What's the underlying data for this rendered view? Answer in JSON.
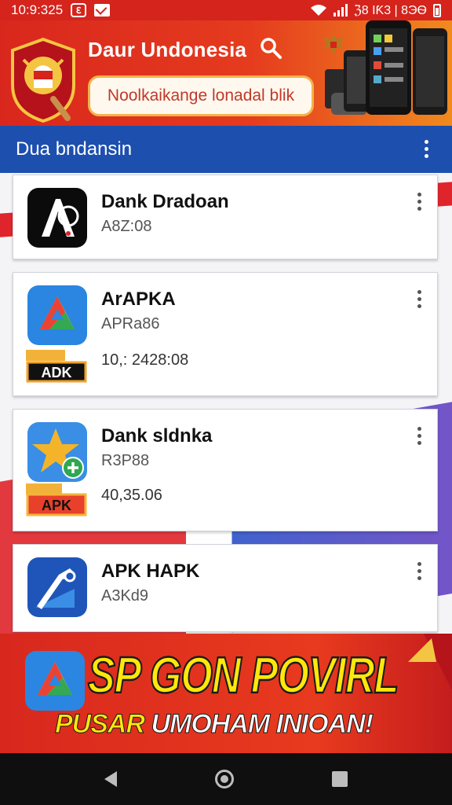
{
  "status_bar": {
    "time": "10:9:325",
    "right_text": "ℨ8 IƘ3 | 8ЭѲ"
  },
  "header": {
    "title": "Daur Undonesia",
    "search_placeholder": "Noolkaikange lonadal blik",
    "brand_color": "#d9271d"
  },
  "section": {
    "title": "Dua bndansin",
    "color": "#1d4fae"
  },
  "apps": [
    {
      "name": "Dank Dradoan",
      "version": "A8Z:08",
      "extra": "",
      "badge": "",
      "icon": "A-logo-icon"
    },
    {
      "name": "ArAPKA",
      "version": "APRa86",
      "extra": "10,: 2428:08",
      "badge": "ADK",
      "icon": "drive-triangle-icon"
    },
    {
      "name": "Dank sldnka",
      "version": "R3P88",
      "extra": "40,35.06",
      "badge": "APK",
      "icon": "star-plus-icon"
    },
    {
      "name": "APK HAPK",
      "version": "A3Kd9",
      "extra": "",
      "badge": "",
      "icon": "pen-tool-icon"
    }
  ],
  "banner": {
    "headline": "SP GON POVIRL",
    "sub_yellow": "PUSAR",
    "sub_white": "UMOHAM INIOAN!"
  }
}
